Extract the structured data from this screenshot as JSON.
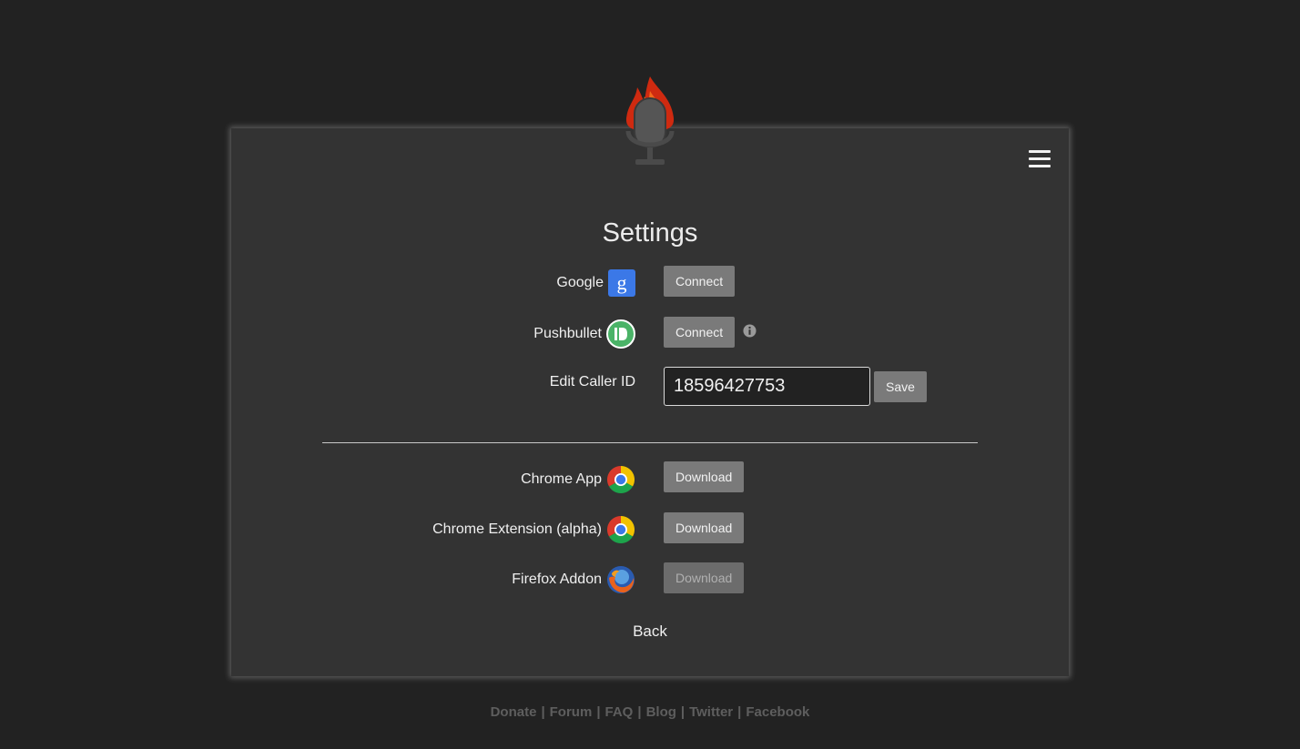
{
  "settings": {
    "title": "Settings",
    "google_label": "Google",
    "google_button": "Connect",
    "pushbullet_label": "Pushbullet",
    "pushbullet_button": "Connect",
    "caller_id_label": "Edit Caller ID",
    "caller_id_value": "18596427753",
    "save_button": "Save"
  },
  "downloads": {
    "chrome_app_label": "Chrome App",
    "chrome_app_button": "Download",
    "chrome_ext_label": "Chrome Extension (alpha)",
    "chrome_ext_button": "Download",
    "firefox_label": "Firefox Addon",
    "firefox_button": "Download"
  },
  "back_label": "Back",
  "footer": {
    "links": [
      "Donate",
      "Forum",
      "FAQ",
      "Blog",
      "Twitter",
      "Facebook"
    ],
    "separator": "|"
  },
  "icons": {
    "logo": "flaming-microphone-icon",
    "menu": "hamburger-menu-icon",
    "google": "google-g-icon",
    "pushbullet": "pushbullet-icon",
    "info": "info-icon",
    "chrome": "chrome-icon",
    "firefox": "firefox-icon"
  },
  "colors": {
    "background": "#222222",
    "panel": "#333333",
    "button": "#7a7a7a",
    "google_blue": "#3b78e7",
    "pushbullet_green": "#4ab367"
  }
}
